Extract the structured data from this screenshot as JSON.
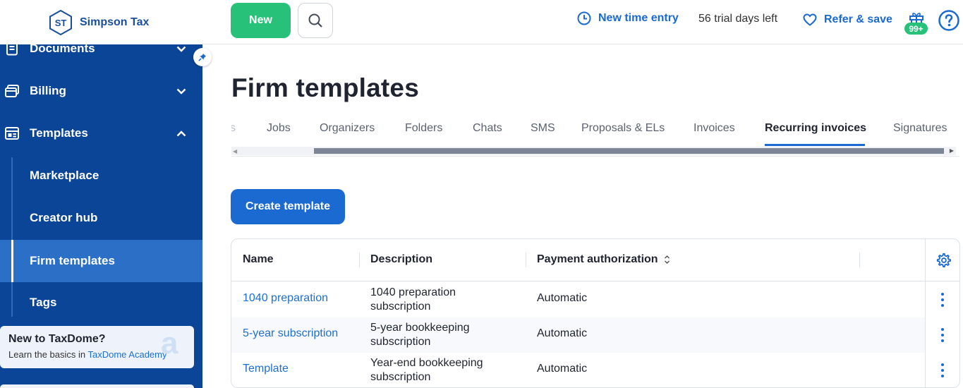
{
  "brand": {
    "initials": "ST",
    "name": "Simpson Tax"
  },
  "sidebar": {
    "items": [
      {
        "label": "Documents",
        "icon": "document-icon",
        "chevron": "chevron-down-icon"
      },
      {
        "label": "Billing",
        "icon": "billing-icon",
        "chevron": "chevron-down-icon"
      },
      {
        "label": "Templates",
        "icon": "templates-icon",
        "chevron": "chevron-up-icon"
      }
    ],
    "sub_items": [
      {
        "label": "Marketplace"
      },
      {
        "label": "Creator hub"
      },
      {
        "label": "Firm templates",
        "active": true
      },
      {
        "label": "Tags"
      }
    ],
    "promo": {
      "title": "New to TaxDome?",
      "text": "Learn the basics in ",
      "link": "TaxDome Academy"
    }
  },
  "topbar": {
    "new_label": "New",
    "time_entry_label": "New time entry",
    "trial_text": "56 trial days left",
    "refer_label": "Refer & save",
    "notifications_badge": "99+"
  },
  "main": {
    "title": "Firm templates",
    "tabs": [
      {
        "label": "s"
      },
      {
        "label": "Jobs"
      },
      {
        "label": "Organizers"
      },
      {
        "label": "Folders"
      },
      {
        "label": "Chats"
      },
      {
        "label": "SMS"
      },
      {
        "label": "Proposals & ELs"
      },
      {
        "label": "Invoices"
      },
      {
        "label": "Recurring invoices",
        "active": true
      },
      {
        "label": "Signatures"
      }
    ],
    "create_label": "Create template",
    "table": {
      "columns": [
        "Name",
        "Description",
        "Payment authorization"
      ],
      "rows": [
        {
          "name": "1040 preparation",
          "description": "1040 preparation subscription",
          "payment": "Automatic"
        },
        {
          "name": "5-year subscription",
          "description": "5-year bookkeeping subscription",
          "payment": "Automatic"
        },
        {
          "name": "Template",
          "description": "Year-end bookkeeping subscription",
          "payment": "Automatic"
        }
      ]
    }
  },
  "colors": {
    "sidebar": "#0b4597",
    "active_item": "#2c6fc6",
    "accent": "#1b6ad1",
    "new_button": "#28c17a"
  }
}
